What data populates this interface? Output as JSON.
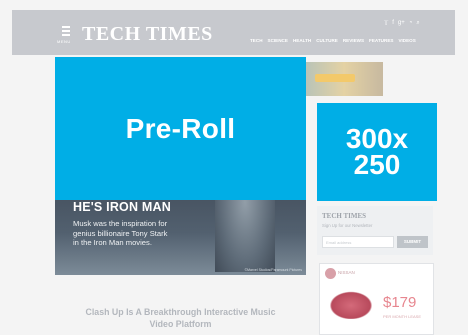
{
  "header": {
    "logo": "TECH TIMES",
    "menu_label": "MENU",
    "nav": [
      "TECH",
      "SCIENCE",
      "HEALTH",
      "CULTURE",
      "REVIEWS",
      "FEATURES",
      "VIDEOS"
    ],
    "social_icons": [
      "twitter-icon",
      "facebook-icon",
      "google-plus-icon",
      "rss-icon",
      "search-icon"
    ]
  },
  "banner": {
    "pill_text": ""
  },
  "preroll": {
    "label": "Pre-Roll"
  },
  "ad300": {
    "line1": "300x",
    "line2": "250"
  },
  "video": {
    "headline": "HE'S IRON MAN",
    "caption_lines": [
      "Musk was the inspiration for",
      "genius billionaire Tony Stark",
      "in the Iron Man movies."
    ],
    "credit": "©Marvel Studios/Paramount Pictures"
  },
  "newsletter": {
    "logo": "TECH TIMES",
    "text": "Sign Up for our Newsletter",
    "input_placeholder": "Email address",
    "button_label": "SUBMIT"
  },
  "carad": {
    "title": "NISSAN",
    "price": "$179",
    "terms": "PER MONTH LEASE"
  },
  "article": {
    "title_lines": [
      "Clash Up Is A Breakthrough Interactive Music",
      "Video Platform"
    ]
  }
}
